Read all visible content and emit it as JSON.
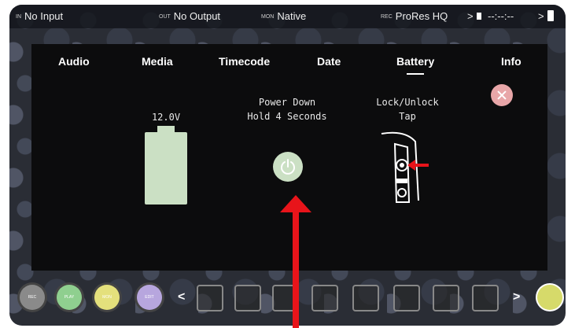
{
  "status_bar": {
    "input_tag": "IN",
    "input": "No Input",
    "output_tag": "OUT",
    "output": "No Output",
    "monitor_tag": "MON",
    "monitor": "Native",
    "rec_tag": "REC",
    "codec": "ProRes HQ",
    "timecode": "--:--:--"
  },
  "tabs": [
    "Audio",
    "Media",
    "Timecode",
    "Date",
    "Battery",
    "Info"
  ],
  "active_tab": "Battery",
  "battery_panel": {
    "voltage": "12.0V",
    "power_down_line1": "Power Down",
    "power_down_line2": "Hold 4 Seconds",
    "lock_line1": "Lock/Unlock",
    "lock_line2": "Tap"
  },
  "bottom_buttons": [
    "REC",
    "PLAY",
    "MON",
    "EDIT"
  ],
  "colors": {
    "battery_fill": "#cbe0c4",
    "close_button": "#e8a6a8",
    "annotation_arrow": "#e8141a",
    "rec_button": "#8a8a8a",
    "play_button": "#8fcf8f",
    "mon_button": "#e4e07c",
    "edit_button": "#b7a6de"
  }
}
